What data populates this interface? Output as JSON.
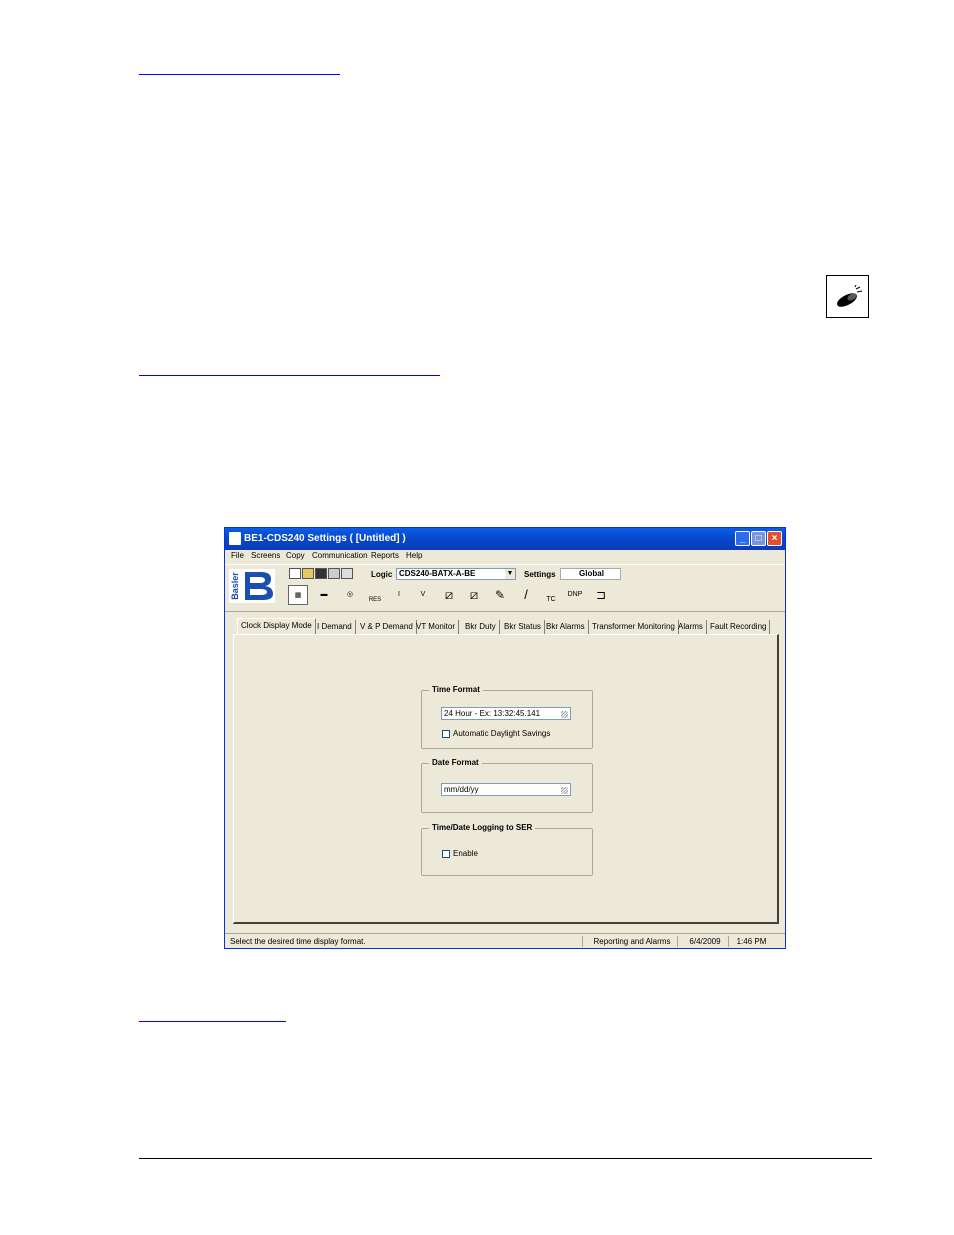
{
  "window": {
    "title": "BE1-CDS240 Settings   ( [Untitled] )",
    "min_glyph": "_",
    "max_glyph": "□",
    "close_glyph": "×"
  },
  "menu": [
    "File",
    "Screens",
    "Copy",
    "Communication",
    "Reports",
    "Help"
  ],
  "toolbar": {
    "logo_text": "Basler",
    "logic_label": "Logic",
    "logic_value": "CDS240-BATX-A-BE",
    "settings_label": "Settings",
    "settings_value": "Global",
    "dropdown_glyph": "▼",
    "tools": [
      {
        "name": "grid-icon",
        "glyph": "▦"
      },
      {
        "name": "relay-icon",
        "glyph": "▬"
      },
      {
        "name": "dial-icon",
        "glyph": "◎"
      },
      {
        "name": "res-curve-icon",
        "glyph": "RES"
      },
      {
        "name": "current-icon",
        "glyph": "I"
      },
      {
        "name": "voltage-icon",
        "glyph": "V"
      },
      {
        "name": "diff-icon",
        "glyph": "⧄"
      },
      {
        "name": "diff2-icon",
        "glyph": "⧄"
      },
      {
        "name": "reporting-icon",
        "glyph": "✎"
      },
      {
        "name": "io-icon",
        "glyph": "/"
      },
      {
        "name": "tc-icon",
        "glyph": "TC"
      },
      {
        "name": "dnp-icon",
        "glyph": "DNP"
      },
      {
        "name": "logic-icon",
        "glyph": "⊐"
      }
    ]
  },
  "tabs": [
    "Clock Display Mode",
    "I Demand",
    "V & P Demand",
    "VT Monitor",
    "Bkr Duty",
    "Bkr Status",
    "Bkr Alarms",
    "Transformer Monitoring",
    "Alarms",
    "Fault Recording"
  ],
  "time_format": {
    "title": "Time Format",
    "value": "24 Hour - Ex: 13:32:45.141",
    "dst_label": "Automatic Daylight Savings",
    "dst_checked": false
  },
  "date_format": {
    "title": "Date Format",
    "value": "mm/dd/yy"
  },
  "logging": {
    "title": "Time/Date Logging to SER",
    "enable_label": "Enable",
    "enable_checked": false
  },
  "status": {
    "message": "Select the desired time display format.",
    "screen": "Reporting and Alarms",
    "date": "6/4/2009",
    "time": "1:46 PM"
  }
}
